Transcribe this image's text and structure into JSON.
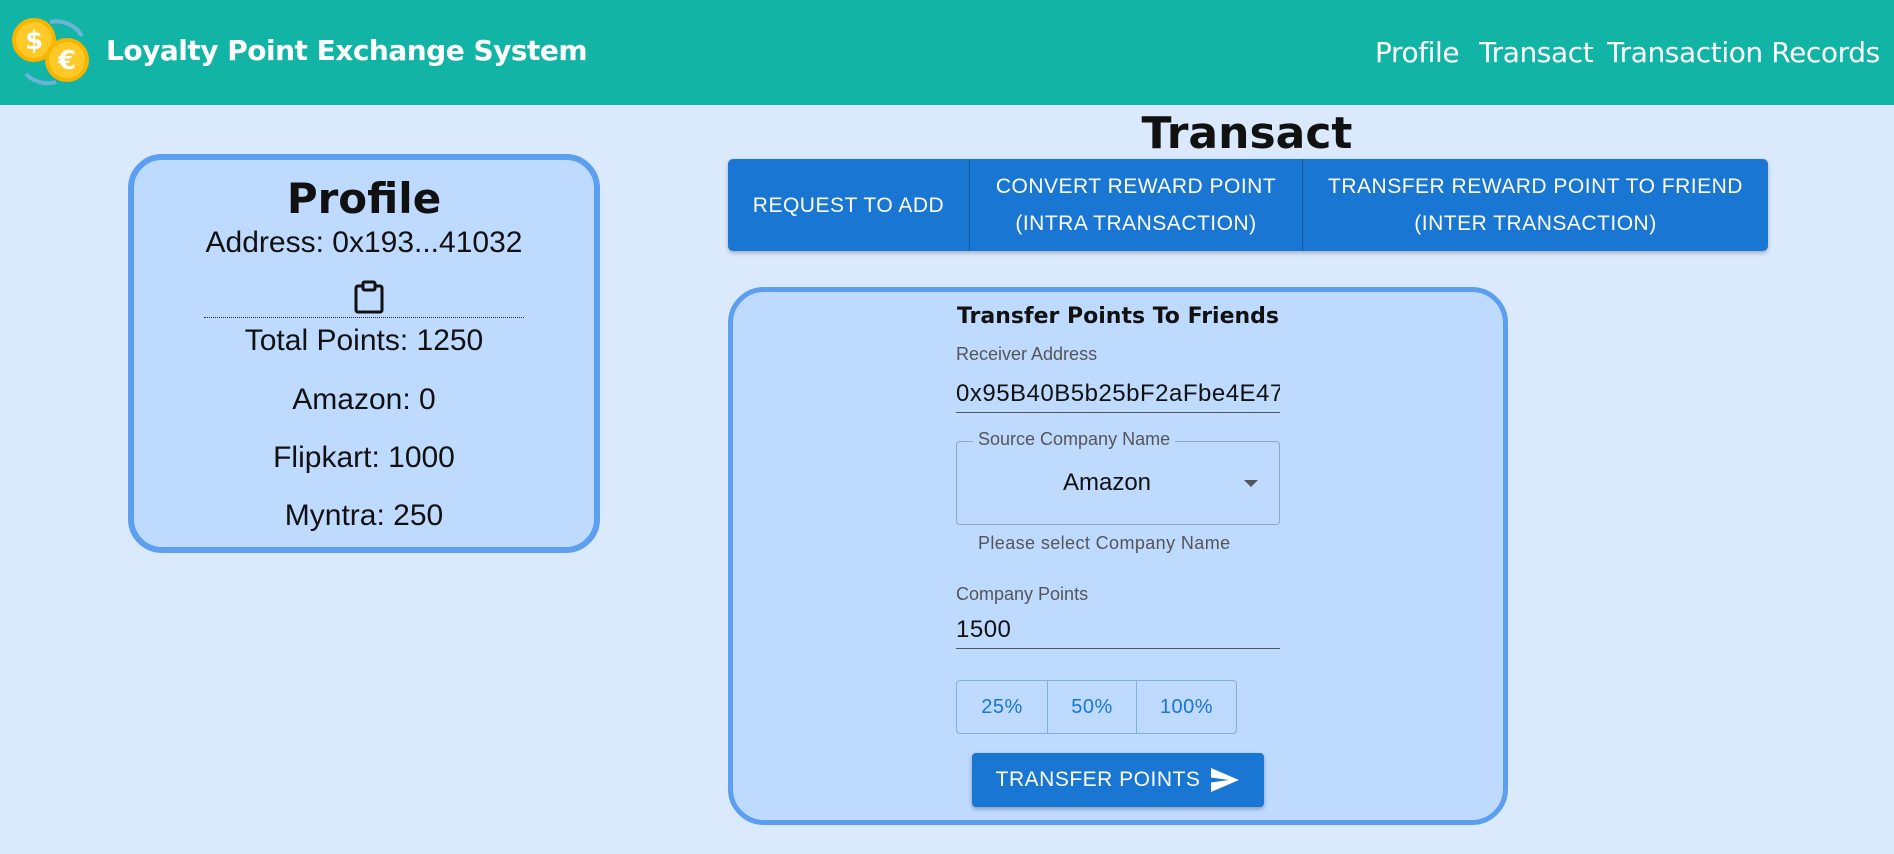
{
  "header": {
    "app_title": "Loyalty Point Exchange System",
    "nav": {
      "profile": "Profile",
      "transact": "Transact",
      "records": "Transaction Records"
    }
  },
  "profile": {
    "title": "Profile",
    "address": "Address: 0x193...41032",
    "total_points": "Total Points: 1250",
    "companies": {
      "amazon": "Amazon: 0",
      "flipkart": "Flipkart: 1000",
      "myntra": "Myntra: 250"
    }
  },
  "transact": {
    "title": "Transact",
    "tabs": {
      "request": "REQUEST TO ADD",
      "convert_line1": "CONVERT REWARD POINT",
      "convert_line2": "(INTRA TRANSACTION)",
      "transfer_line1": "TRANSFER REWARD POINT TO FRIEND",
      "transfer_line2": "(INTER TRANSACTION)"
    }
  },
  "transfer_form": {
    "title": "Transfer Points To Friends",
    "receiver_label": "Receiver Address",
    "receiver_value": "0x95B40B5b25bF2aFbe4E47",
    "company_label": "Source Company Name",
    "company_value": "Amazon",
    "company_helper": "Please select Company Name",
    "points_label": "Company Points",
    "points_value": "1500",
    "pct_buttons": {
      "p25": "25%",
      "p50": "50%",
      "p100": "100%"
    },
    "submit_label": "TRANSFER POINTS"
  },
  "colors": {
    "header_bg": "#12b5a5",
    "page_bg": "#dbe9fd",
    "card_bg": "#bedaff",
    "card_border": "#5c9ff0",
    "primary": "#1976d2"
  },
  "icons": {
    "logo": "coin-exchange-logo-icon",
    "clipboard": "clipboard-icon",
    "dropdown": "caret-down-icon",
    "send": "send-icon"
  }
}
